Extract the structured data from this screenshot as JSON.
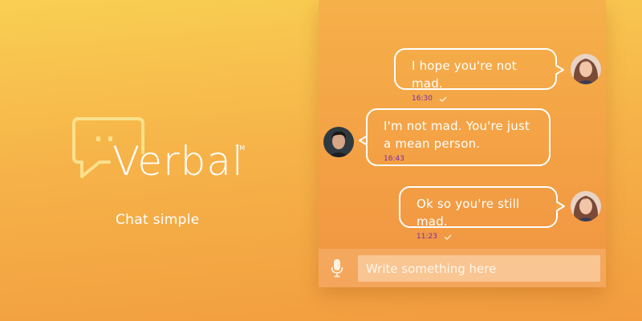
{
  "brand": {
    "name": "Verbal",
    "trademark": "TM",
    "tagline": "Chat simple"
  },
  "colors": {
    "accent_white": "#ffffff",
    "timestamp": "#7b2aa8",
    "background_top": "#f9cf52",
    "background_bottom": "#f29c3f"
  },
  "chat": {
    "messages": [
      {
        "side": "outgoing",
        "text": "I hope you're not mad.",
        "time": "16:30",
        "status_icon": "check-icon"
      },
      {
        "side": "incoming",
        "text": "I'm not mad. You're just a mean person.",
        "time": "16:43"
      },
      {
        "side": "outgoing",
        "text": "Ok so you're still mad.",
        "time": "11:23",
        "status_icon": "check-icon"
      }
    ]
  },
  "composer": {
    "mic_icon": "microphone-icon",
    "placeholder": "Write something here"
  }
}
